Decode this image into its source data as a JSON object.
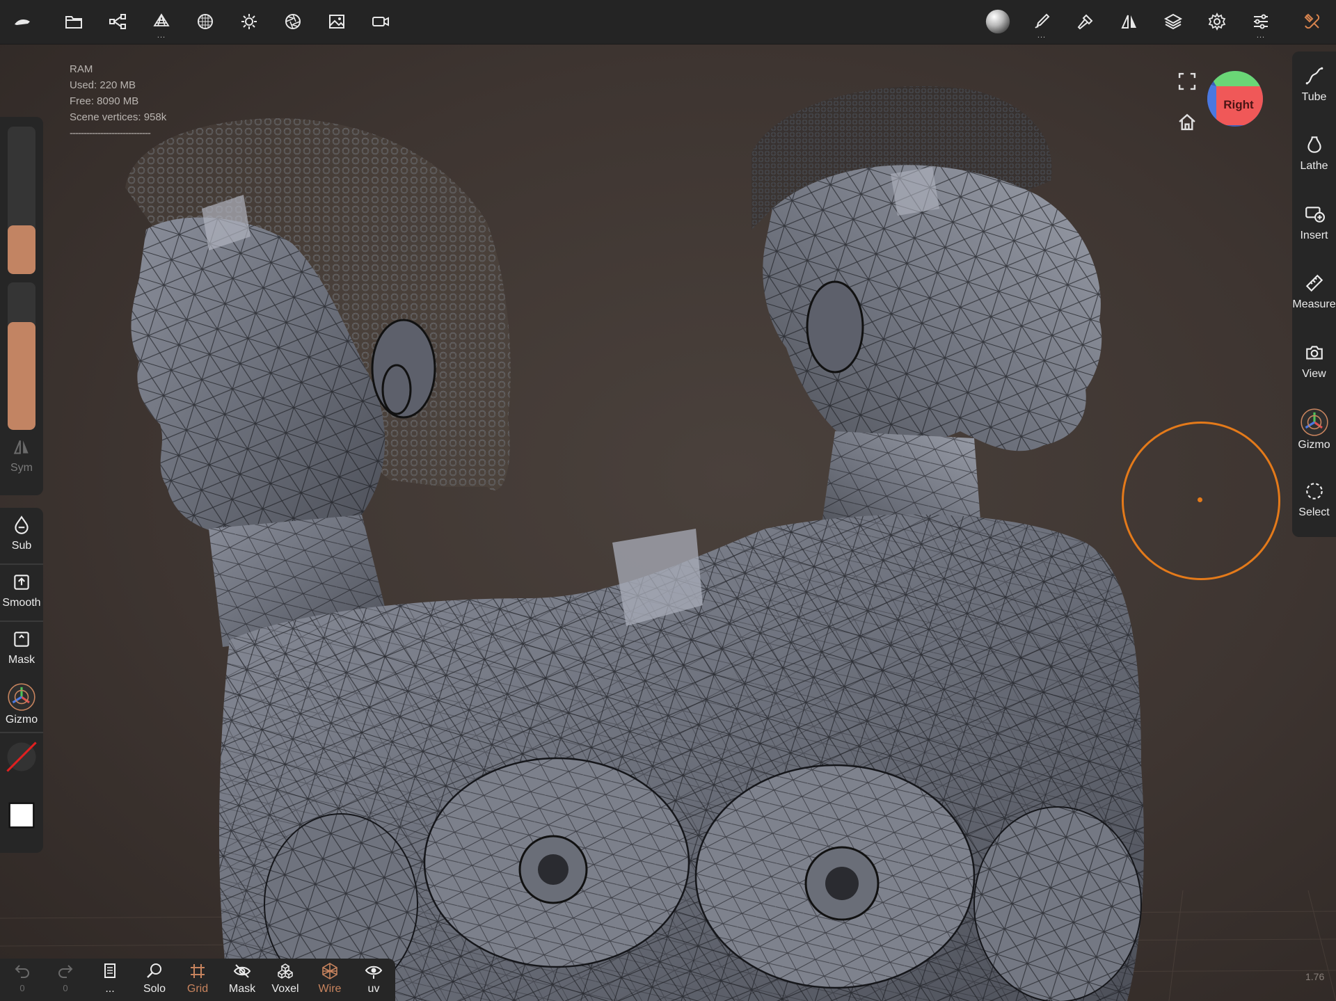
{
  "topbar": {
    "left_icons": [
      "app-logo-icon",
      "folder-icon",
      "scene-graph-icon",
      "topology-icon",
      "material-sphere-icon",
      "light-icon",
      "aperture-icon",
      "image-icon",
      "video-camera-icon"
    ],
    "right_icons": [
      "matcap-preview-icon",
      "brush-tool-icon",
      "hammer-icon",
      "symmetry-icon",
      "layers-icon",
      "settings-gear-icon",
      "sliders-icon",
      "tools-icon"
    ],
    "more_indicator": "..."
  },
  "ram": {
    "title": "RAM",
    "used": "Used: 220 MB",
    "free": "Free: 8090 MB",
    "vertices": "Scene vertices: 958k",
    "separator": "-----------------------------"
  },
  "left_panel": {
    "radius_fraction": 0.33,
    "intensity_fraction": 0.73,
    "sym_label": "Sym",
    "sub_label": "Sub",
    "smooth_label": "Smooth",
    "mask_label": "Mask",
    "gizmo_label": "Gizmo",
    "accent_color": "#c28463"
  },
  "right_panel": {
    "tube_label": "Tube",
    "lathe_label": "Lathe",
    "insert_label": "Insert",
    "measure_label": "Measure",
    "view_label": "View",
    "gizmo_label": "Gizmo",
    "select_label": "Select"
  },
  "viewcube": {
    "face_label": "Right",
    "face_color": "#f05050",
    "top_color": "#5ed06a",
    "front_color": "#4a78e0"
  },
  "bottombar": {
    "undo_count": "0",
    "redo_count": "0",
    "more_label": "...",
    "solo_label": "Solo",
    "grid_label": "Grid",
    "mask_label": "Mask",
    "voxel_label": "Voxel",
    "wire_label": "Wire",
    "uv_label": "uv"
  },
  "brush_color": "#e47a1a",
  "zoom_level": "1.76"
}
